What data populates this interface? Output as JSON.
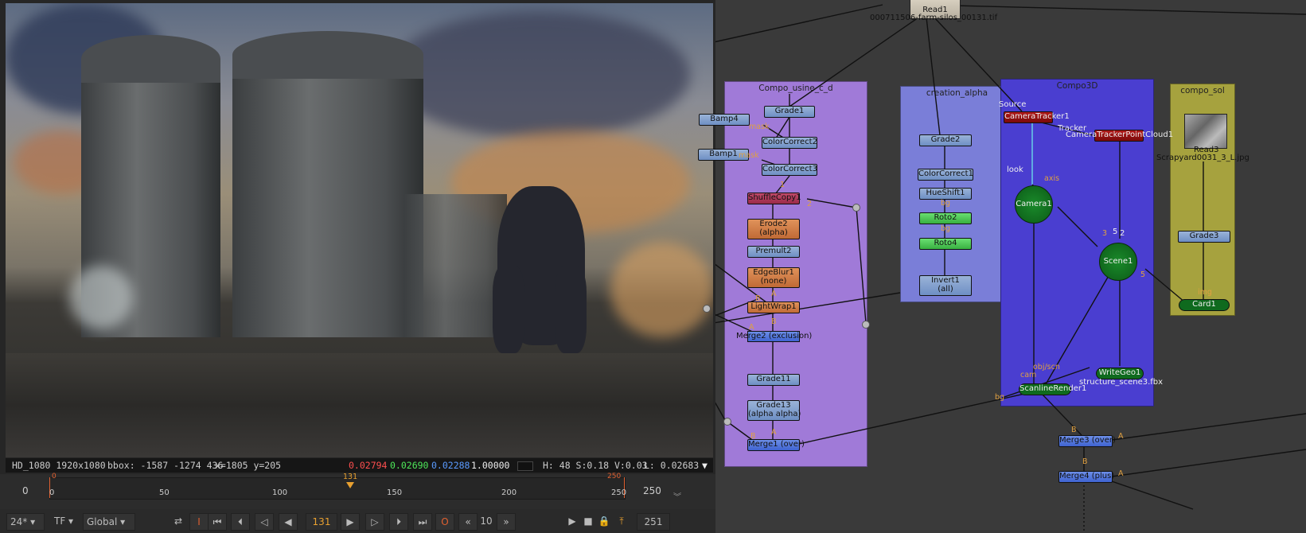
{
  "viewer": {
    "info": {
      "format": "HD_1080 1920x1080",
      "bbox": "bbox: -1587 -1274 436",
      "coords": "x=1805 y=205",
      "r": "0.02794",
      "g": "0.02690",
      "b": "0.02288",
      "a": "1.00000",
      "hsv": "H: 48 S:0.18 V:0.03",
      "lum": "L: 0.02683"
    },
    "timeline": {
      "start_label": "0",
      "in_marker": "0",
      "current_marker": "131",
      "out_marker": "250",
      "end_label": "250",
      "ticks": [
        "0",
        "50",
        "100",
        "150",
        "200",
        "250"
      ]
    },
    "controls": {
      "fps": "24*",
      "tf": "TF",
      "scope": "Global",
      "current_frame": "131",
      "step": "10",
      "end_frame": "251"
    }
  },
  "graph": {
    "backdrops": {
      "usine": "Compo_usine_c_d",
      "alpha": "creation_alpha",
      "compo3d": "Compo3D",
      "sol": "compo_sol"
    },
    "read1": {
      "name": "Read1",
      "file": "000711506-farm-silos_00131.tif"
    },
    "read3": {
      "name": "Read3",
      "file": "Scrapyard0031_3_L.jpg"
    },
    "nodes": {
      "grade1": "Grade1",
      "bamp4": "Bamp4",
      "bamp1": "Bamp1",
      "colorcorrect2": "ColorCorrect2",
      "colorcorrect3": "ColorCorrect3",
      "shufflecopy1": "ShuffleCopy1",
      "erode2": "Erode2",
      "erode2_sub": "(alpha)",
      "premult2": "Premult2",
      "edgeblur1": "EdgeBlur1",
      "edgeblur1_sub": "(none)",
      "lightwrap1": "LightWrap1",
      "merge2": "Merge2 (exclusion)",
      "grade11": "Grade11",
      "grade13": "Grade13",
      "grade13_sub": "(alpha alpha)",
      "merge1": "Merge1 (over)",
      "grade2": "Grade2",
      "colorcorrect1": "ColorCorrect1",
      "hueshift1": "HueShift1",
      "roto2": "Roto2",
      "roto4": "Roto4",
      "invert1": "Invert1",
      "invert1_sub": "(all)",
      "cameratracker1": "CameraTracker1",
      "trackerpointcloud1": "CameraTrackerPointCloud1",
      "camera1": "Camera1",
      "scene1": "Scene1",
      "writegeo1": "WriteGeo1",
      "writegeo1_file": "structure_scene3.fbx",
      "scanlinerender1": "ScanlineRender1",
      "grade3": "Grade3",
      "card1": "Card1",
      "merge3": "Merge3 (over)",
      "merge4": "Merge4 (plus)"
    },
    "labels": {
      "mask_a": "mask",
      "mask_b": "mask",
      "source": "Source",
      "tracker": "Tracker",
      "look": "look",
      "axis": "axis",
      "obj_scn": "obj/scn",
      "cam": "cam",
      "bg1": "bg",
      "bg2": "bg",
      "bg3": "bg",
      "img": "img",
      "in1": "1",
      "in2": "2",
      "in3": "3",
      "in5": "5",
      "in2b": "2",
      "in5b": "5",
      "a1": "A",
      "a2": "A",
      "a3": "A",
      "a4": "A",
      "a5": "A",
      "b1": "B",
      "b2": "B",
      "b3": "B",
      "b4": "B",
      "b5": "B",
      "b6": "B"
    }
  },
  "colors": {
    "red": "#ff4040",
    "green": "#3ee84a",
    "blue": "#4a8bff",
    "timeline_accent": "#e06030",
    "current_frame": "#e8a030"
  }
}
